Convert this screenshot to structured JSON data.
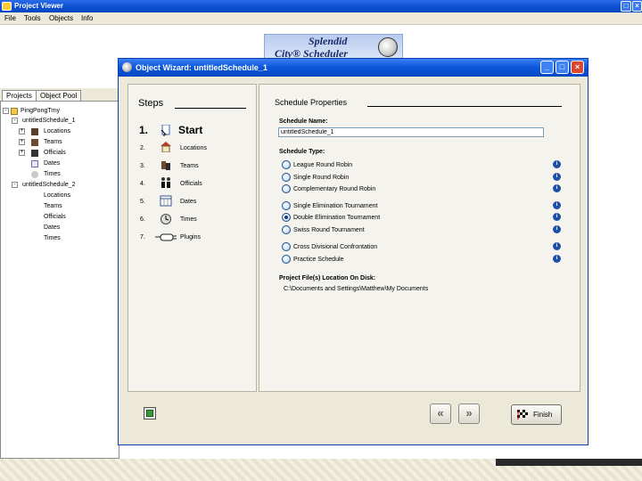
{
  "project_viewer": {
    "title": "Project Viewer",
    "menus": [
      "File",
      "Tools",
      "Objects",
      "Info"
    ],
    "logo_line1": "Splendid",
    "logo_line2": "City® Scheduler",
    "tabs": [
      "Projects",
      "Object Pool"
    ],
    "tree": {
      "root": "PingPongTrny",
      "schedules": [
        {
          "label": "untitledSchedule_1",
          "children": [
            "Locations",
            "Teams",
            "Officials",
            "Dates",
            "Times"
          ]
        },
        {
          "label": "untitledSchedule_2",
          "children": [
            "Locations",
            "Teams",
            "Officials",
            "Dates",
            "Times"
          ]
        }
      ]
    }
  },
  "wizard": {
    "title": "Object Wizard: untitledSchedule_1",
    "steps_heading": "Steps",
    "steps": [
      {
        "num": "1.",
        "label": "Start",
        "icon": "pointer-page-icon"
      },
      {
        "num": "2.",
        "label": "Locations",
        "icon": "house-icon"
      },
      {
        "num": "3.",
        "label": "Teams",
        "icon": "team-icon"
      },
      {
        "num": "4.",
        "label": "Officials",
        "icon": "officials-icon"
      },
      {
        "num": "5.",
        "label": "Dates",
        "icon": "calendar-icon"
      },
      {
        "num": "6.",
        "label": "Times",
        "icon": "clock-icon"
      },
      {
        "num": "7.",
        "label": "Plugins",
        "icon": "plugin-icon"
      }
    ],
    "properties_heading": "Schedule Properties",
    "schedule_name_label": "Schedule Name:",
    "schedule_name_value": "untitledSchedule_1",
    "schedule_type_label": "Schedule Type:",
    "schedule_types": [
      {
        "label": "League Round Robin",
        "checked": false
      },
      {
        "label": "Single Round Robin",
        "checked": false
      },
      {
        "label": "Complementary Round Robin",
        "checked": false
      },
      {
        "label": "Single Elimination Tournament",
        "checked": false
      },
      {
        "label": "Double Elimination Tournament",
        "checked": true
      },
      {
        "label": "Swiss Round Tournament",
        "checked": false
      },
      {
        "label": "Cross Divisional Confrontation",
        "checked": false
      },
      {
        "label": "Practice Schedule",
        "checked": false
      }
    ],
    "path_label": "Project File(s) Location On Disk:",
    "path_value": "C:\\Documents and Settings\\Matthew\\My Documents",
    "finish_label": "Finish"
  },
  "colors": {
    "titlebar": "#0a4fd0",
    "dialog_face": "#ece9d8",
    "panel": "#f4f3ee"
  }
}
